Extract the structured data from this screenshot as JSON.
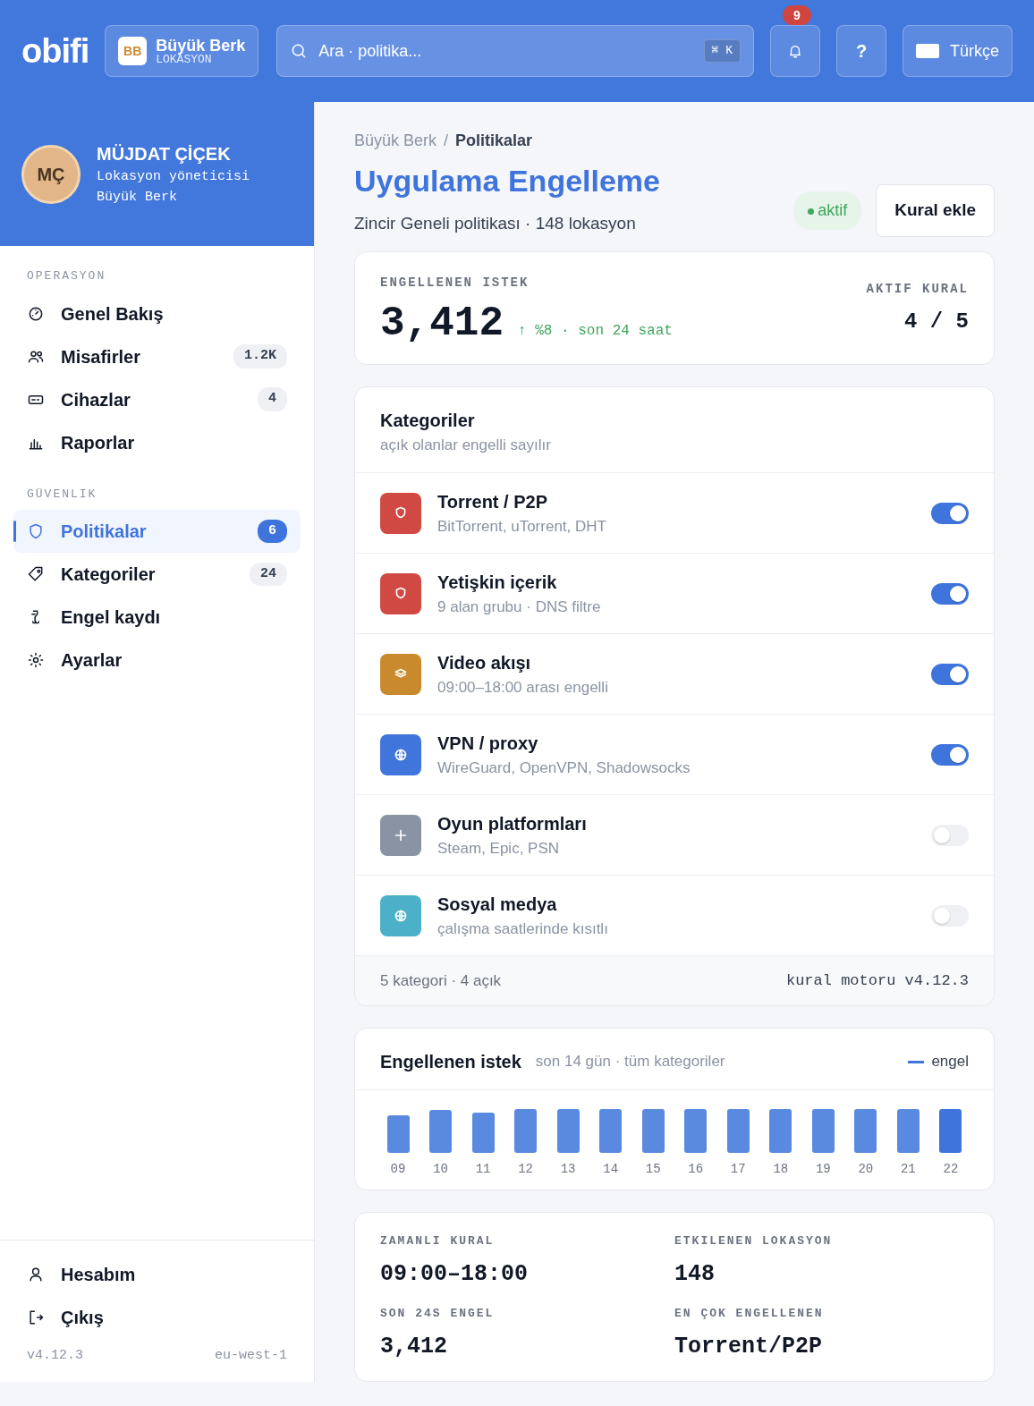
{
  "header": {
    "logo": "obifi",
    "location": {
      "initials": "BB",
      "name": "Büyük Berk",
      "label": "LOKASYON"
    },
    "search": {
      "placeholder": "Ara · politika...",
      "shortcut": "⌘ K"
    },
    "notifications": "9",
    "help": "?",
    "language": "Türkçe"
  },
  "profile": {
    "initials": "MÇ",
    "name": "MÜJDAT ÇİÇEK",
    "role": "Lokasyon yöneticisi",
    "location": "Büyük Berk"
  },
  "sidebar": {
    "sections": [
      {
        "title": "OPERASYON",
        "items": [
          {
            "label": "Genel Bakış",
            "selected": false
          },
          {
            "label": "Misafirler",
            "count": "1.2K",
            "selected": false
          },
          {
            "label": "Cihazlar",
            "count": "4",
            "selected": false
          },
          {
            "label": "Raporlar",
            "selected": false
          }
        ]
      },
      {
        "title": "GÜVENLIK",
        "items": [
          {
            "label": "Politikalar",
            "count": "6",
            "selected": true
          },
          {
            "label": "Kategoriler",
            "count": "24",
            "selected": false
          },
          {
            "label": "Engel kaydı",
            "selected": false
          },
          {
            "label": "Ayarlar",
            "selected": false
          }
        ]
      }
    ],
    "footer_items": [
      "Hesabım",
      "Çıkış"
    ],
    "version": "v4.12.3",
    "region": "eu-west-1"
  },
  "breadcrumb": {
    "items": [
      "Büyük Berk",
      "Politikalar"
    ],
    "separator": "/"
  },
  "page": {
    "title": "Uygulama Engelleme",
    "subtitle": "Zincir Geneli politikası · 148 lokasyon",
    "status": "aktif",
    "action": "Kural ekle"
  },
  "summary": {
    "label": "ENGELLENEN ISTEK",
    "value": "3,412",
    "trend": "↑ %8 · son 24 saat",
    "side_label": "AKTIF KURAL",
    "side_value": "4 / 5"
  },
  "categories": {
    "title": "Kategoriler",
    "subtitle": "açık olanlar engelli sayılır",
    "items": [
      {
        "name": "Torrent / P2P",
        "detail": "BitTorrent, uTorrent, DHT",
        "color": "#d04a43",
        "on": true
      },
      {
        "name": "Yetişkin içerik",
        "detail": "9 alan grubu · DNS filtre",
        "color": "#d04a43",
        "on": true
      },
      {
        "name": "Video akışı",
        "detail": "09:00–18:00 arası engelli",
        "color": "#c98a2e",
        "on": true
      },
      {
        "name": "VPN / proxy",
        "detail": "WireGuard, OpenVPN, Shadowsocks",
        "color": "#4076dc",
        "on": true
      },
      {
        "name": "Oyun platformları",
        "detail": "Steam, Epic, PSN",
        "color": "#8a93a3",
        "on": false
      },
      {
        "name": "Sosyal medya",
        "detail": "çalışma saatlerinde kısıtlı",
        "color": "#4bb0c8",
        "on": false
      }
    ],
    "footer": "5 kategori · 4 açık",
    "engine": "kural motoru v4.12.3"
  },
  "chart": {
    "title": "Engellenen istek",
    "subtitle": "son 14 gün · tüm kategoriler",
    "legend": "engel",
    "days": [
      {
        "label": "09",
        "current": false
      },
      {
        "label": "10",
        "current": false
      },
      {
        "label": "11",
        "current": false
      },
      {
        "label": "12",
        "current": false
      },
      {
        "label": "13",
        "current": false
      },
      {
        "label": "14",
        "current": false
      },
      {
        "label": "15",
        "current": false
      },
      {
        "label": "16",
        "current": false
      },
      {
        "label": "17",
        "current": false
      },
      {
        "label": "18",
        "current": false
      },
      {
        "label": "19",
        "current": false
      },
      {
        "label": "20",
        "current": false
      },
      {
        "label": "21",
        "current": false
      },
      {
        "label": "22",
        "current": true
      }
    ]
  },
  "facts": [
    {
      "label": "ZAMANLI KURAL",
      "value": "09:00–18:00"
    },
    {
      "label": "ETKILENEN LOKASYON",
      "value": "148"
    },
    {
      "label": "SON 24S ENGEL",
      "value": "3,412"
    },
    {
      "label": "EN ÇOK ENGELLENEN",
      "value": "Torrent/P2P"
    }
  ]
}
